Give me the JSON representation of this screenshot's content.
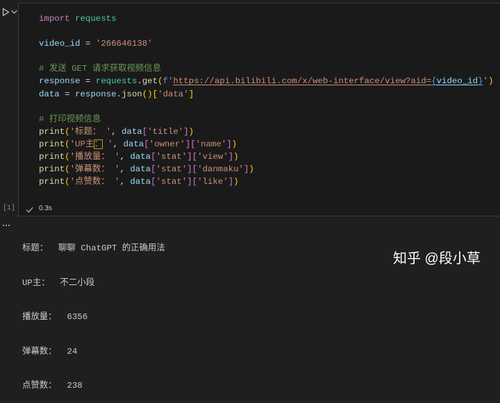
{
  "theme": {
    "page_background": "#1f1f1f",
    "cell_background": "#1a1a1a",
    "cell_border": "#3c3c3c",
    "output_text": "#cccccc",
    "success": "#89d185",
    "watermark": "#ffffff"
  },
  "icons": {
    "run": "run-icon",
    "collapse": "chevron-down-icon",
    "success": "check-icon",
    "more": "ellipsis-icon"
  },
  "cell": {
    "execution_count": "[1]",
    "duration": "0.3s",
    "code_lines": [
      [
        {
          "t": "import",
          "c": "#c586c0"
        },
        {
          "t": " ",
          "c": "#d4d4d4"
        },
        {
          "t": "requests",
          "c": "#4ec9b0"
        }
      ],
      [],
      [
        {
          "t": "video_id",
          "c": "#9cdcfe"
        },
        {
          "t": " = ",
          "c": "#d4d4d4"
        },
        {
          "t": "'266646138'",
          "c": "#ce9178"
        }
      ],
      [],
      [
        {
          "t": "# 发送 GET 请求获取视频信息",
          "c": "#6a9955"
        }
      ],
      [
        {
          "t": "response",
          "c": "#9cdcfe"
        },
        {
          "t": " = ",
          "c": "#d4d4d4"
        },
        {
          "t": "requests",
          "c": "#4ec9b0"
        },
        {
          "t": ".",
          "c": "#d4d4d4"
        },
        {
          "t": "get",
          "c": "#dcdcaa"
        },
        {
          "t": "(",
          "c": "#ffd700"
        },
        {
          "t": "f",
          "c": "#569cd6"
        },
        {
          "t": "'",
          "c": "#ce9178"
        },
        {
          "t": "https://api.bilibili.com/x/web-interface/view?aid=",
          "c": "#ce9178",
          "u": true
        },
        {
          "t": "{",
          "c": "#569cd6",
          "u": true
        },
        {
          "t": "video_id",
          "c": "#9cdcfe",
          "u": true
        },
        {
          "t": "}",
          "c": "#569cd6",
          "u": true
        },
        {
          "t": "'",
          "c": "#ce9178"
        },
        {
          "t": ")",
          "c": "#ffd700"
        }
      ],
      [
        {
          "t": "data",
          "c": "#9cdcfe"
        },
        {
          "t": " = ",
          "c": "#d4d4d4"
        },
        {
          "t": "response",
          "c": "#9cdcfe"
        },
        {
          "t": ".",
          "c": "#d4d4d4"
        },
        {
          "t": "json",
          "c": "#dcdcaa"
        },
        {
          "t": "()",
          "c": "#ffd700"
        },
        {
          "t": "[",
          "c": "#ffd700"
        },
        {
          "t": "'data'",
          "c": "#ce9178"
        },
        {
          "t": "]",
          "c": "#ffd700"
        }
      ],
      [],
      [
        {
          "t": "# 打印视频信息",
          "c": "#6a9955"
        }
      ],
      [
        {
          "t": "print",
          "c": "#dcdcaa"
        },
        {
          "t": "(",
          "c": "#ffd700"
        },
        {
          "t": "'标题： '",
          "c": "#ce9178"
        },
        {
          "t": ", ",
          "c": "#d4d4d4"
        },
        {
          "t": "data",
          "c": "#9cdcfe"
        },
        {
          "t": "[",
          "c": "#da70d6"
        },
        {
          "t": "'title'",
          "c": "#ce9178"
        },
        {
          "t": "]",
          "c": "#da70d6"
        },
        {
          "t": ")",
          "c": "#ffd700"
        }
      ],
      [
        {
          "t": "print",
          "c": "#dcdcaa"
        },
        {
          "t": "(",
          "c": "#ffd700"
        },
        {
          "t": "'UP主",
          "c": "#ce9178"
        },
        {
          "t": "：",
          "c": "#ce9178",
          "box": true
        },
        {
          "t": " '",
          "c": "#ce9178"
        },
        {
          "t": ", ",
          "c": "#d4d4d4"
        },
        {
          "t": "data",
          "c": "#9cdcfe"
        },
        {
          "t": "[",
          "c": "#da70d6"
        },
        {
          "t": "'owner'",
          "c": "#ce9178"
        },
        {
          "t": "]",
          "c": "#da70d6"
        },
        {
          "t": "[",
          "c": "#da70d6"
        },
        {
          "t": "'name'",
          "c": "#ce9178"
        },
        {
          "t": "]",
          "c": "#da70d6"
        },
        {
          "t": ")",
          "c": "#ffd700"
        }
      ],
      [
        {
          "t": "print",
          "c": "#dcdcaa"
        },
        {
          "t": "(",
          "c": "#ffd700"
        },
        {
          "t": "'播放量： '",
          "c": "#ce9178"
        },
        {
          "t": ", ",
          "c": "#d4d4d4"
        },
        {
          "t": "data",
          "c": "#9cdcfe"
        },
        {
          "t": "[",
          "c": "#da70d6"
        },
        {
          "t": "'stat'",
          "c": "#ce9178"
        },
        {
          "t": "]",
          "c": "#da70d6"
        },
        {
          "t": "[",
          "c": "#da70d6"
        },
        {
          "t": "'view'",
          "c": "#ce9178"
        },
        {
          "t": "]",
          "c": "#da70d6"
        },
        {
          "t": ")",
          "c": "#ffd700"
        }
      ],
      [
        {
          "t": "print",
          "c": "#dcdcaa"
        },
        {
          "t": "(",
          "c": "#ffd700"
        },
        {
          "t": "'弹幕数： '",
          "c": "#ce9178"
        },
        {
          "t": ", ",
          "c": "#d4d4d4"
        },
        {
          "t": "data",
          "c": "#9cdcfe"
        },
        {
          "t": "[",
          "c": "#da70d6"
        },
        {
          "t": "'stat'",
          "c": "#ce9178"
        },
        {
          "t": "]",
          "c": "#da70d6"
        },
        {
          "t": "[",
          "c": "#da70d6"
        },
        {
          "t": "'danmaku'",
          "c": "#ce9178"
        },
        {
          "t": "]",
          "c": "#da70d6"
        },
        {
          "t": ")",
          "c": "#ffd700"
        }
      ],
      [
        {
          "t": "print",
          "c": "#dcdcaa"
        },
        {
          "t": "(",
          "c": "#ffd700"
        },
        {
          "t": "'点赞数： '",
          "c": "#ce9178"
        },
        {
          "t": ", ",
          "c": "#d4d4d4"
        },
        {
          "t": "data",
          "c": "#9cdcfe"
        },
        {
          "t": "[",
          "c": "#da70d6"
        },
        {
          "t": "'stat'",
          "c": "#ce9178"
        },
        {
          "t": "]",
          "c": "#da70d6"
        },
        {
          "t": "[",
          "c": "#da70d6"
        },
        {
          "t": "'like'",
          "c": "#ce9178"
        },
        {
          "t": "]",
          "c": "#da70d6"
        },
        {
          "t": ")",
          "c": "#ffd700"
        }
      ]
    ]
  },
  "output": {
    "lines": [
      "标题：  聊聊 ChatGPT 的正确用法",
      "UP主：  不二小段",
      "播放量：  6356",
      "弹幕数：  24",
      "点赞数：  238"
    ]
  },
  "watermark": "知乎 @段小草"
}
